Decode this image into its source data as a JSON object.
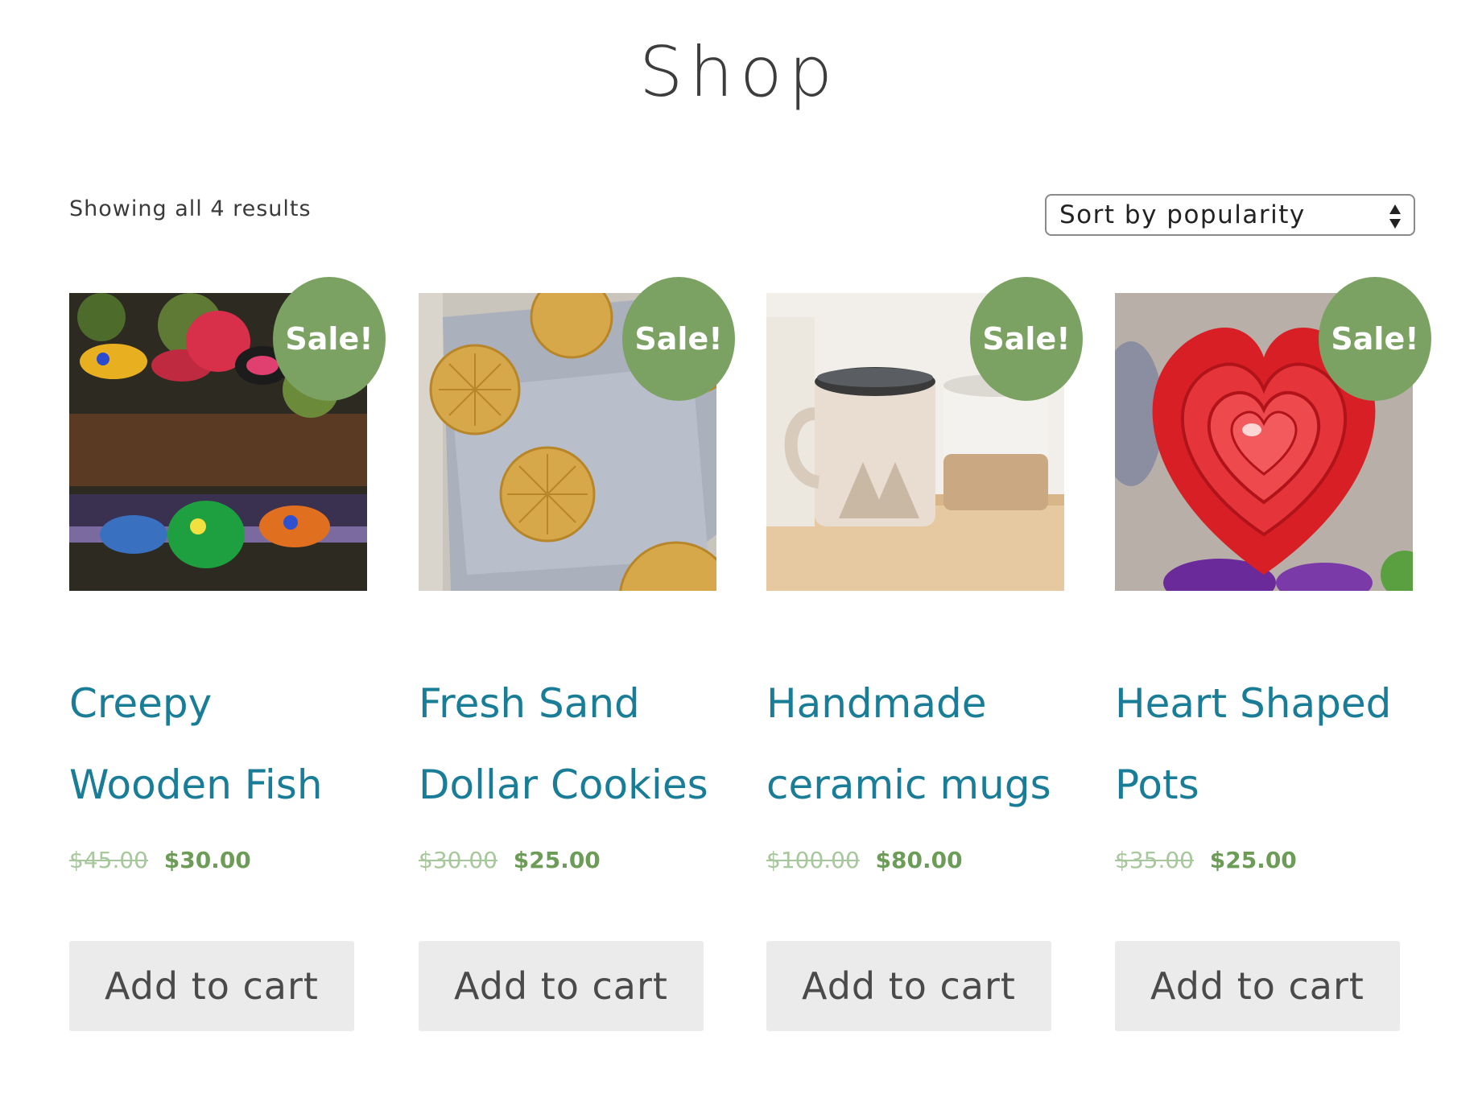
{
  "page": {
    "title": "Shop"
  },
  "toolbar": {
    "result_count": "Showing all 4 results",
    "orderby_label": "Sort by popularity"
  },
  "products": [
    {
      "name_line1": "Creepy",
      "name_line2": "Wooden Fish",
      "regular_price": "$45.00",
      "sale_price": "$30.00",
      "badge": "Sale!",
      "button": "Add to cart",
      "image_icon": "hanging-fish-ornaments-image"
    },
    {
      "name_line1": "Fresh Sand",
      "name_line2": "Dollar Cookies",
      "regular_price": "$30.00",
      "sale_price": "$25.00",
      "badge": "Sale!",
      "button": "Add to cart",
      "image_icon": "cookies-on-napkin-image"
    },
    {
      "name_line1": "Handmade",
      "name_line2": "ceramic mugs",
      "regular_price": "$100.00",
      "sale_price": "$80.00",
      "badge": "Sale!",
      "button": "Add to cart",
      "image_icon": "ceramic-mugs-image"
    },
    {
      "name_line1": "Heart Shaped",
      "name_line2": "Pots",
      "regular_price": "$35.00",
      "sale_price": "$25.00",
      "badge": "Sale!",
      "button": "Add to cart",
      "image_icon": "heart-bowls-image"
    }
  ],
  "colors": {
    "sale_badge": "#7ba263",
    "product_title": "#1a7d98",
    "sale_price": "#6c9c57",
    "regular_price": "#a7c79c",
    "button_bg": "#ebebeb"
  }
}
